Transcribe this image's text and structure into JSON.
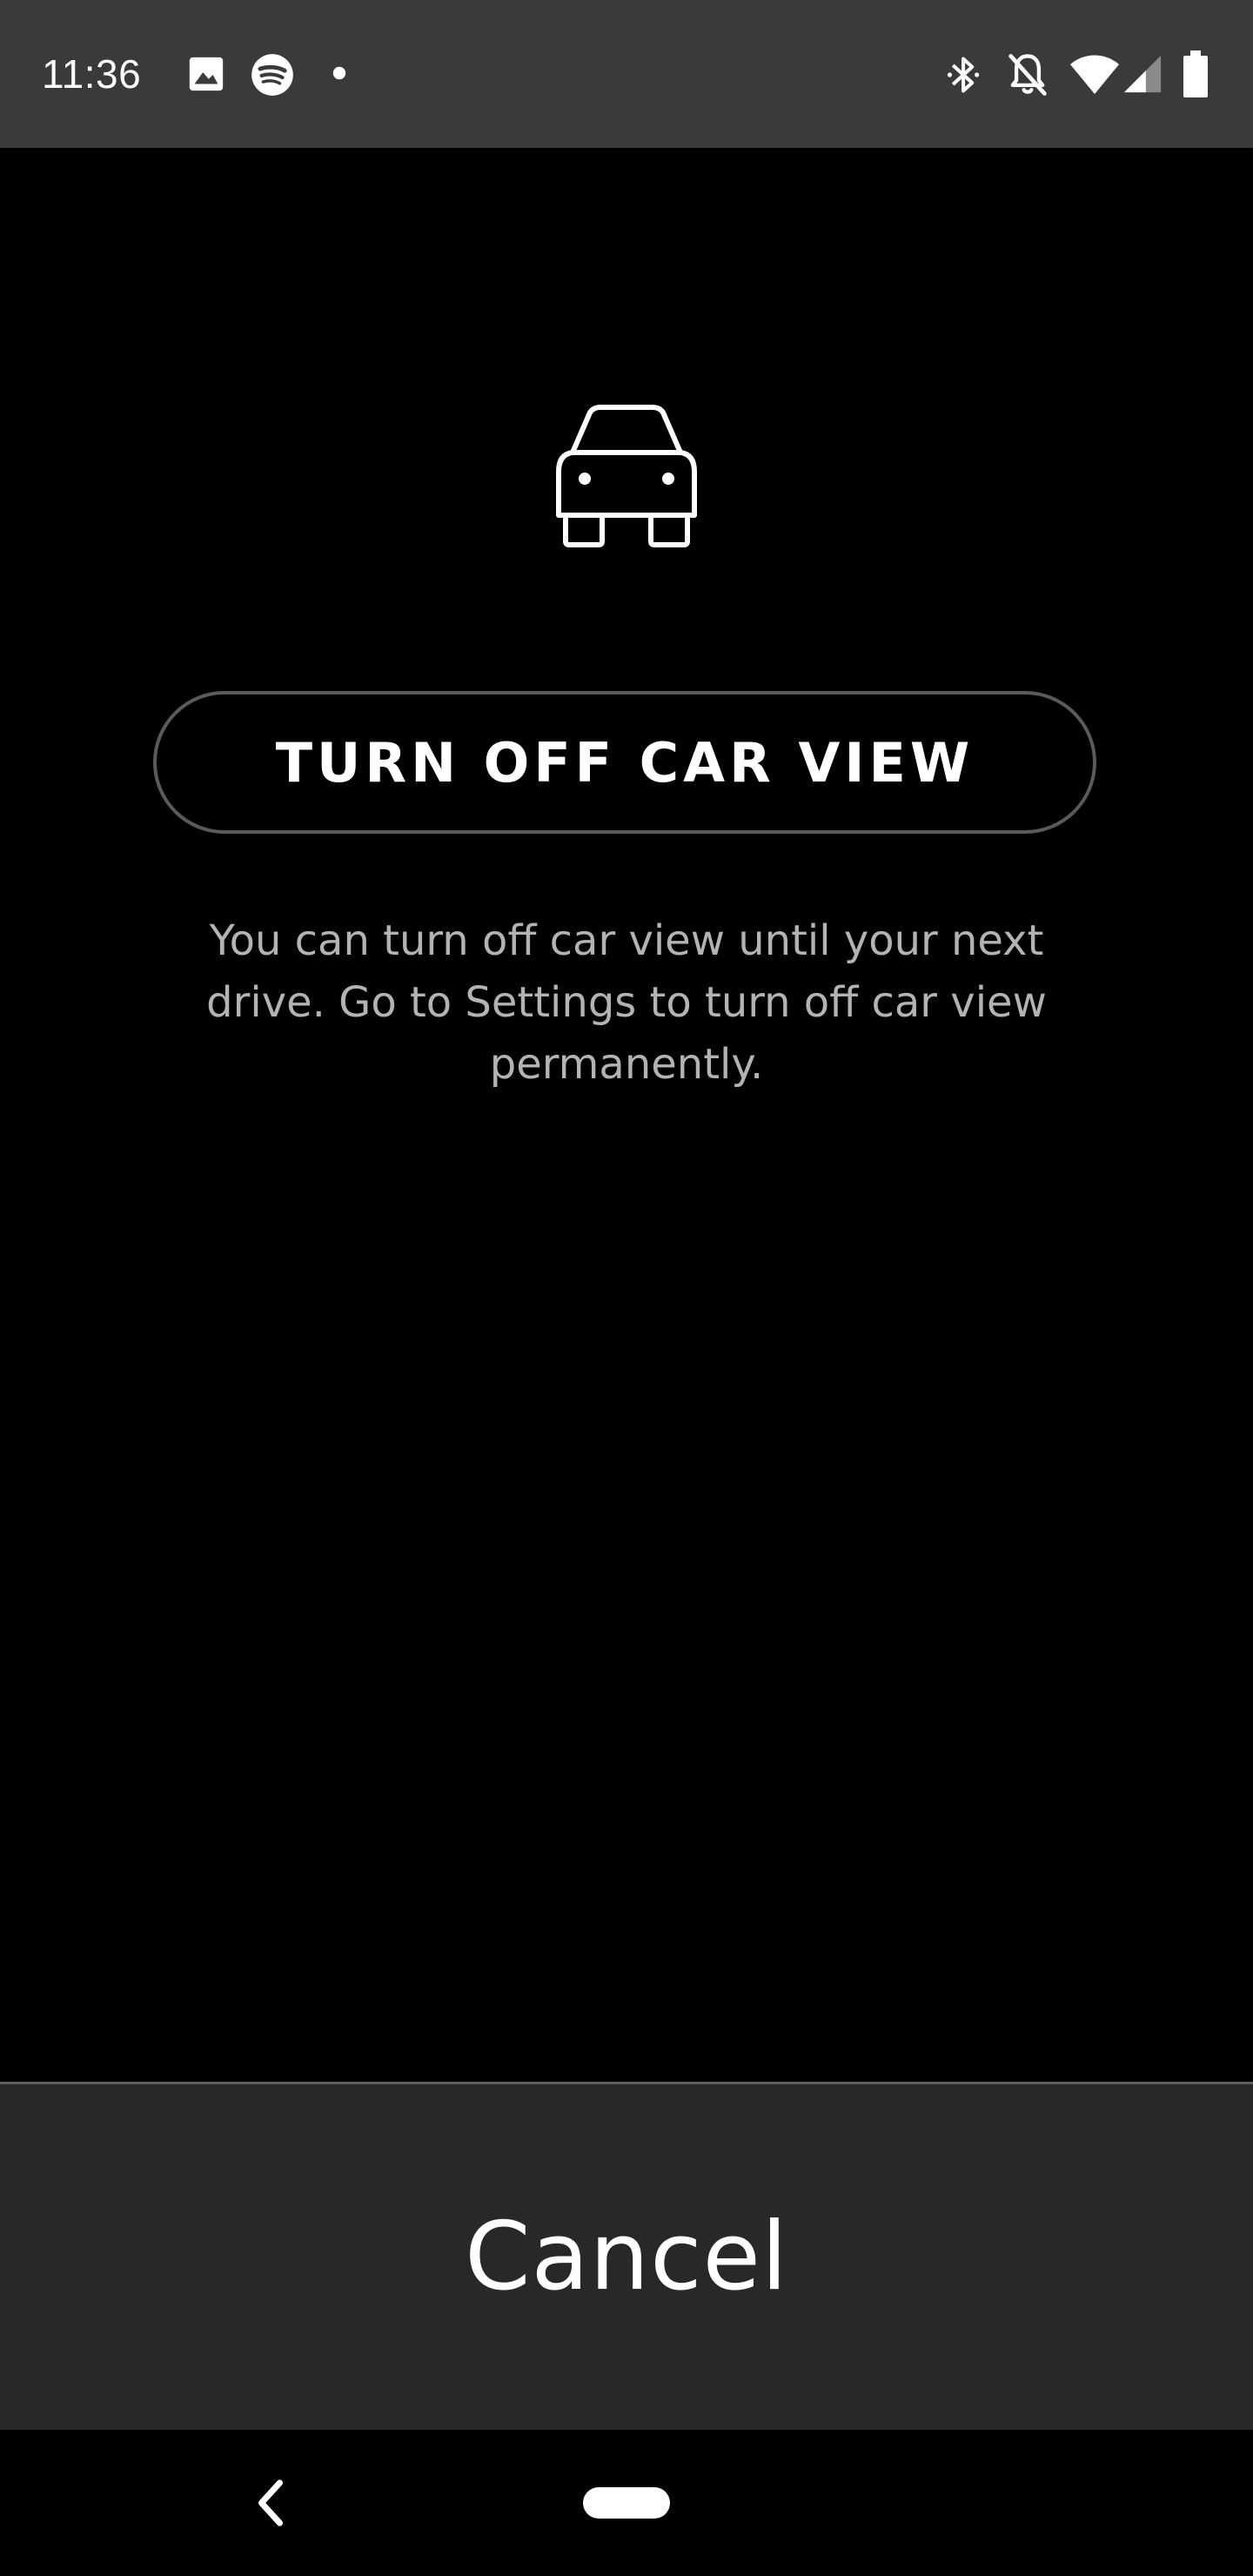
{
  "status_bar": {
    "time": "11:36",
    "left_icons": [
      "image-icon",
      "spotify-icon",
      "notification-dot-icon"
    ],
    "right_icons": [
      "bluetooth-icon",
      "bell-off-icon",
      "wifi-icon",
      "cell-signal-icon",
      "battery-icon"
    ]
  },
  "main": {
    "icon": "car-icon",
    "turn_off_button_label": "TURN OFF CAR VIEW",
    "info_text": "You can turn off car view until your next drive. Go to Settings to turn off car view permanently."
  },
  "cancel": {
    "label": "Cancel"
  },
  "nav_bar": {
    "icons": [
      "back-icon",
      "home-pill"
    ]
  },
  "colors": {
    "background": "#000000",
    "status_bar": "#3a3a3a",
    "button_border": "#5a5a5a",
    "info_text": "#b3b3b3",
    "cancel_background": "#282828",
    "text_primary": "#ffffff"
  }
}
